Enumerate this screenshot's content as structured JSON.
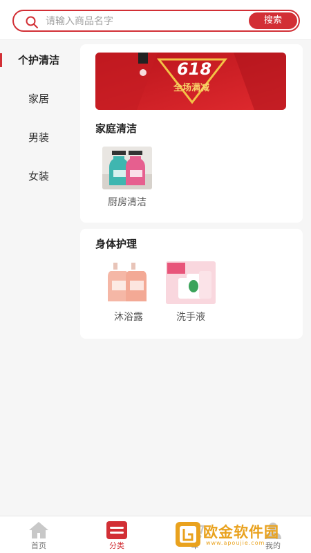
{
  "search": {
    "placeholder": "请输入商品名字",
    "button_label": "搜索"
  },
  "sidebar": {
    "items": [
      {
        "label": "个护清洁",
        "active": true
      },
      {
        "label": "家居",
        "active": false
      },
      {
        "label": "男装",
        "active": false
      },
      {
        "label": "女装",
        "active": false
      }
    ]
  },
  "banner": {
    "headline": "618",
    "subline": "全场满减"
  },
  "sections": [
    {
      "title": "家庭清洁",
      "products": [
        {
          "label": "厨房清洁"
        }
      ]
    },
    {
      "title": "身体护理",
      "products": [
        {
          "label": "沐浴露"
        },
        {
          "label": "洗手液"
        }
      ]
    }
  ],
  "tab_bar": {
    "tabs": [
      {
        "label": "首页",
        "active": false
      },
      {
        "label": "分类",
        "active": true
      },
      {
        "label": "车",
        "active": false
      },
      {
        "label": "我的",
        "active": false
      }
    ]
  },
  "watermark": {
    "text": "欧金软件园",
    "url": "www.apoujie.com"
  },
  "colors": {
    "accent": "#d22f35",
    "watermark": "#e9a21e"
  }
}
